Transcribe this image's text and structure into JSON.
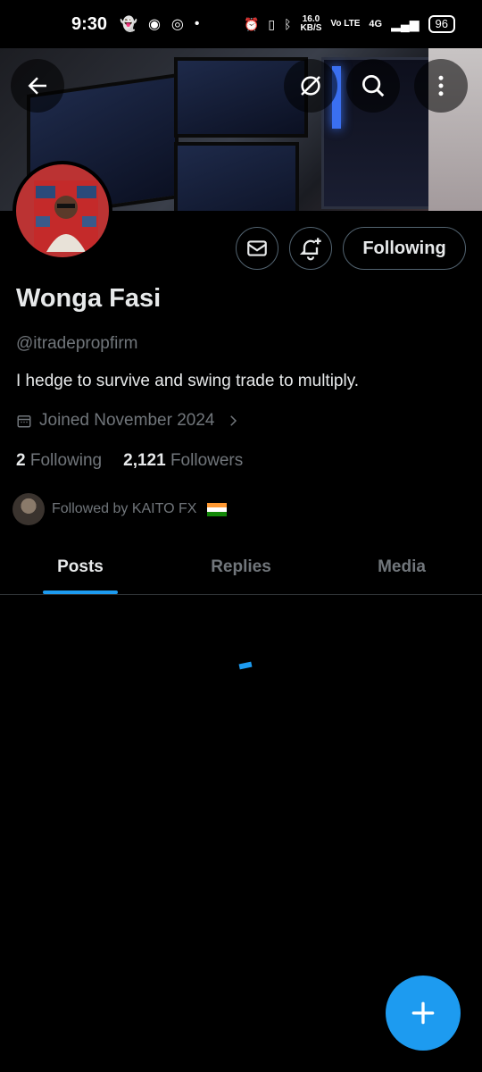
{
  "status_bar": {
    "time": "9:30",
    "speed_value": "16.0",
    "speed_unit": "KB/S",
    "network": "4G",
    "volte": "Vo LTE",
    "battery": "96"
  },
  "profile": {
    "name": "Wonga Fasi",
    "handle": "@itradepropfirm",
    "bio": "I hedge to survive and swing trade to multiply.",
    "joined": "Joined November 2024",
    "following_count": "2",
    "following_label": "Following",
    "followers_count": "2,121",
    "followers_label": "Followers",
    "followed_by": "Followed by KAITO FX"
  },
  "actions": {
    "following_button": "Following"
  },
  "tabs": [
    {
      "label": "Posts",
      "active": true
    },
    {
      "label": "Replies",
      "active": false
    },
    {
      "label": "Media",
      "active": false
    }
  ],
  "colors": {
    "accent": "#1d9bf0",
    "background": "#000000",
    "secondary_text": "#71767b"
  }
}
